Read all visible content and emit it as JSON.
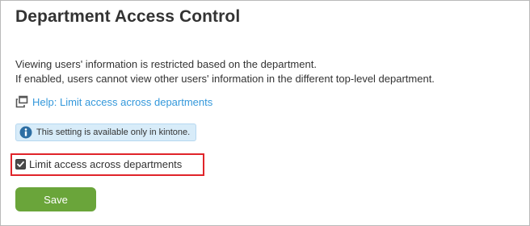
{
  "page": {
    "title": "Department Access Control"
  },
  "description": {
    "line1": "Viewing users' information is restricted based on the department.",
    "line2": "If enabled, users cannot view other users' information in the different top-level department."
  },
  "help": {
    "icon": "external-window-icon",
    "label": "Help: Limit access across departments"
  },
  "notice": {
    "icon": "info-icon",
    "text": "This setting is available only in kintone."
  },
  "setting": {
    "checkbox_label": "Limit access across departments",
    "checked": true,
    "highlight_color": "#e0242a"
  },
  "actions": {
    "save_label": "Save",
    "save_color": "#6aa53a"
  },
  "colors": {
    "link": "#3498db",
    "notice_bg": "#d8ecf9"
  }
}
